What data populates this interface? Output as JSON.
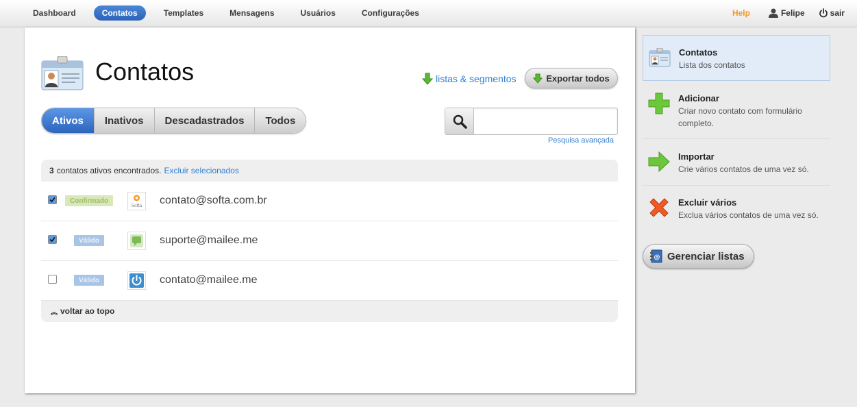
{
  "nav": {
    "items": [
      {
        "label": "Dashboard",
        "active": false
      },
      {
        "label": "Contatos",
        "active": true
      },
      {
        "label": "Templates",
        "active": false
      },
      {
        "label": "Mensagens",
        "active": false
      },
      {
        "label": "Usuários",
        "active": false
      },
      {
        "label": "Configurações",
        "active": false
      }
    ],
    "help": "Help",
    "user": "Felipe",
    "logout": "sair"
  },
  "page": {
    "title": "Contatos",
    "listas_link": "listas & segmentos",
    "export_button": "Exportar todos"
  },
  "tabs": [
    {
      "label": "Ativos",
      "active": true
    },
    {
      "label": "Inativos",
      "active": false
    },
    {
      "label": "Descadastrados",
      "active": false
    },
    {
      "label": "Todos",
      "active": false
    }
  ],
  "search": {
    "value": "",
    "placeholder": "",
    "advanced_link": "Pesquisa avançada"
  },
  "list": {
    "count": "3",
    "header_text": "contatos ativos encontrados.",
    "delete_link": "Excluir selecionados",
    "rows": [
      {
        "checked": true,
        "status": "Confirmado",
        "email": "contato@softa.com.br",
        "avatar": "softa-logo"
      },
      {
        "checked": true,
        "status": "Válido",
        "email": "suporte@mailee.me",
        "avatar": "chat-bubble-icon"
      },
      {
        "checked": false,
        "status": "Válido",
        "email": "contato@mailee.me",
        "avatar": "power-icon"
      }
    ],
    "footer": "voltar ao topo"
  },
  "sidebar": {
    "items": [
      {
        "title": "Contatos",
        "desc": "Lista dos contatos",
        "icon": "id-card-icon"
      },
      {
        "title": "Adicionar",
        "desc": "Criar novo contato com formulário completo.",
        "icon": "plus-icon"
      },
      {
        "title": "Importar",
        "desc": "Crie vários contatos de uma vez só.",
        "icon": "arrow-right-icon"
      },
      {
        "title": "Excluir vários",
        "desc": "Exclua vários contatos de uma vez só.",
        "icon": "x-icon"
      }
    ],
    "manage_button": "Gerenciar listas"
  },
  "colors": {
    "accent": "#2e64bd",
    "link": "#2f7fd1",
    "help": "#f29a27"
  }
}
